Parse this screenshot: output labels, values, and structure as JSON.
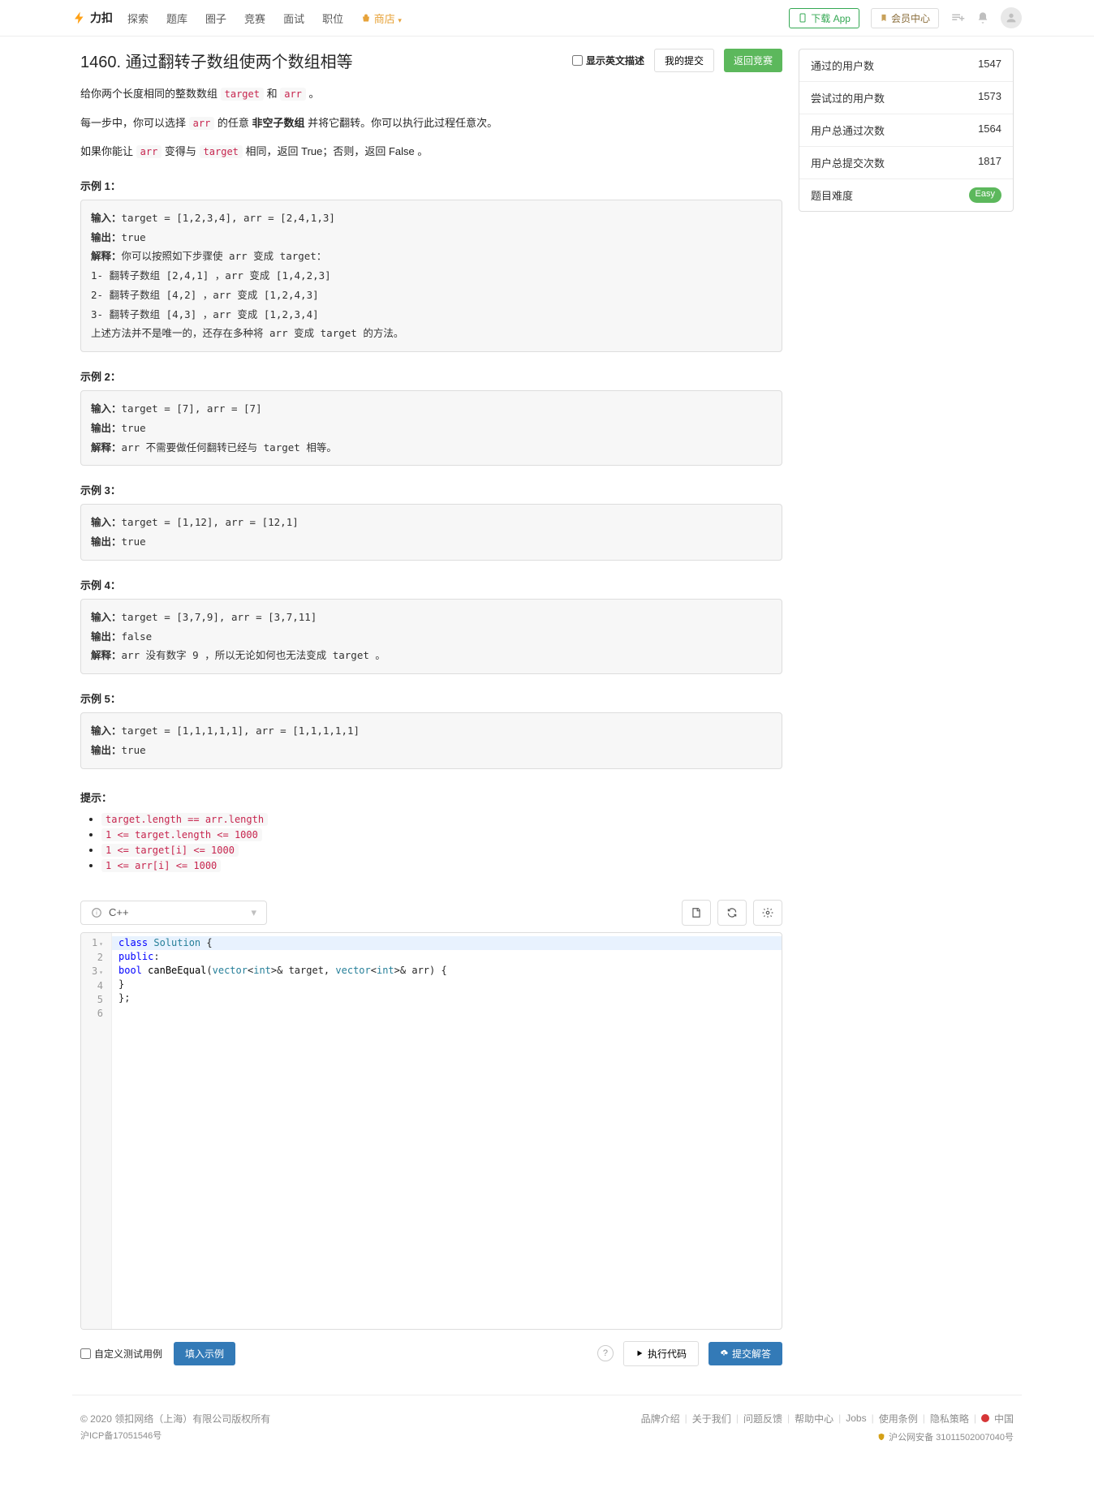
{
  "nav": {
    "brand": "力扣",
    "items": [
      "探索",
      "题库",
      "圈子",
      "竞赛",
      "面试",
      "职位"
    ],
    "shop": "商店",
    "download": "下载 App",
    "vip": "会员中心"
  },
  "title": "1460. 通过翻转子数组使两个数组相等",
  "showEn": "显示英文描述",
  "mySubs": "我的提交",
  "backContest": "返回竞赛",
  "stats": [
    {
      "label": "通过的用户数",
      "value": "1547"
    },
    {
      "label": "尝试过的用户数",
      "value": "1573"
    },
    {
      "label": "用户总通过次数",
      "value": "1564"
    },
    {
      "label": "用户总提交次数",
      "value": "1817"
    },
    {
      "label": "题目难度",
      "value": "Easy",
      "badge": true
    }
  ],
  "desc": {
    "p1a": "给你两个长度相同的整数数组 ",
    "p1b": " 和 ",
    "p1c": " 。",
    "p2a": "每一步中，你可以选择 ",
    "p2b": " 的任意 ",
    "p2c": "非空子数组",
    "p2d": " 并将它翻转。你可以执行此过程任意次。",
    "p3a": "如果你能让 ",
    "p3b": " 变得与 ",
    "p3c": " 相同，返回 True；否则，返回 False 。",
    "c_target": "target",
    "c_arr": "arr"
  },
  "examples": [
    {
      "title": "示例 1：",
      "body": "输入：target = [1,2,3,4], arr = [2,4,1,3]\n输出：true\n解释：你可以按照如下步骤使 arr 变成 target：\n1- 翻转子数组 [2,4,1] ，arr 变成 [1,4,2,3]\n2- 翻转子数组 [4,2] ，arr 变成 [1,2,4,3]\n3- 翻转子数组 [4,3] ，arr 变成 [1,2,3,4]\n上述方法并不是唯一的，还存在多种将 arr 变成 target 的方法。"
    },
    {
      "title": "示例 2：",
      "body": "输入：target = [7], arr = [7]\n输出：true\n解释：arr 不需要做任何翻转已经与 target 相等。"
    },
    {
      "title": "示例 3：",
      "body": "输入：target = [1,12], arr = [12,1]\n输出：true"
    },
    {
      "title": "示例 4：",
      "body": "输入：target = [3,7,9], arr = [3,7,11]\n输出：false\n解释：arr 没有数字 9 ，所以无论如何也无法变成 target 。"
    },
    {
      "title": "示例 5：",
      "body": "输入：target = [1,1,1,1,1], arr = [1,1,1,1,1]\n输出：true"
    }
  ],
  "hintsTitle": "提示：",
  "hints": [
    "target.length == arr.length",
    "1 <= target.length <= 1000",
    "1 <= target[i] <= 1000",
    "1 <= arr[i] <= 1000"
  ],
  "editor": {
    "lang": "C++",
    "lines": [
      "class Solution {",
      "public:",
      "    bool canBeEqual(vector<int>& target, vector<int>& arr) {",
      "        ",
      "    }",
      "};"
    ]
  },
  "bottom": {
    "customTest": "自定义测试用例",
    "fillExample": "填入示例",
    "run": "执行代码",
    "submit": "提交解答"
  },
  "footer": {
    "copyright": "© 2020 领扣网络（上海）有限公司版权所有",
    "icp": "沪ICP备17051546号",
    "links": [
      "品牌介绍",
      "关于我们",
      "问题反馈",
      "帮助中心",
      "Jobs",
      "使用条例",
      "隐私策略"
    ],
    "country": "中国",
    "beian": "沪公网安备 31011502007040号"
  }
}
